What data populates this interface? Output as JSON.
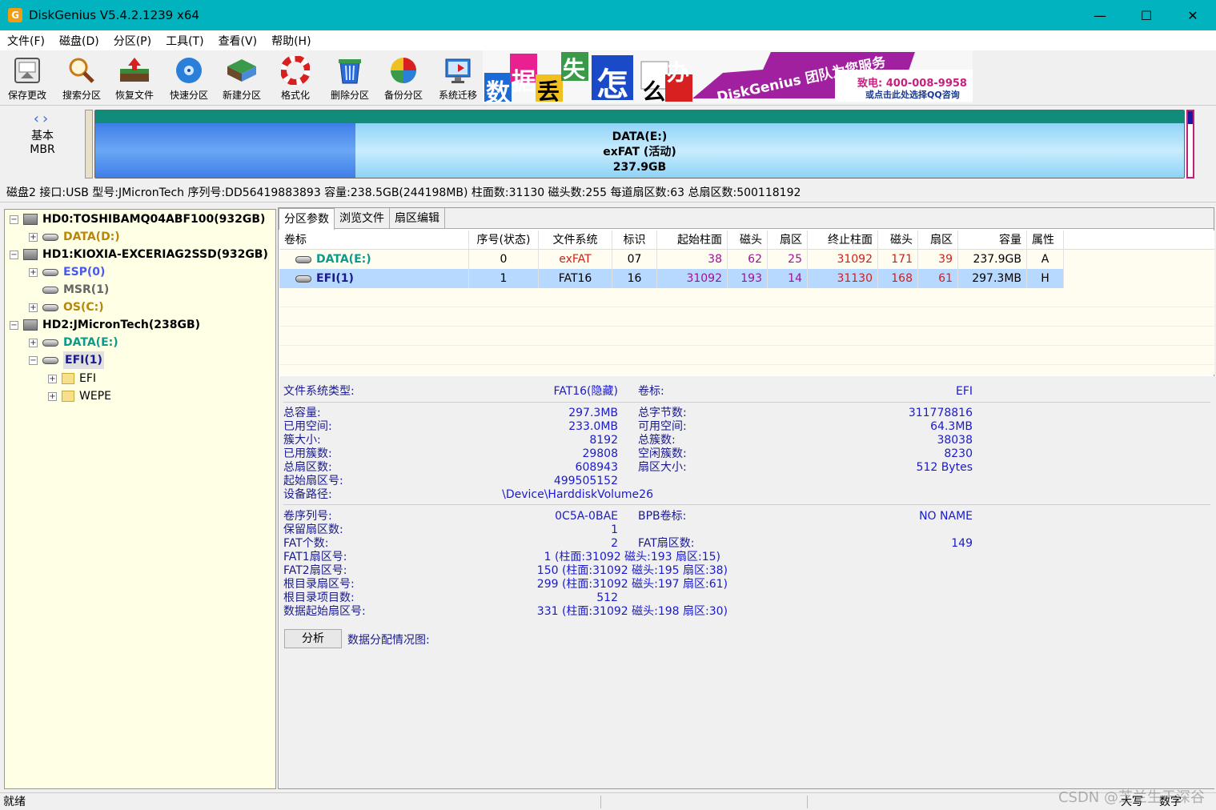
{
  "window": {
    "title": "DiskGenius V5.4.2.1239 x64",
    "app_icon_glyph": "G"
  },
  "menu": [
    "文件(F)",
    "磁盘(D)",
    "分区(P)",
    "工具(T)",
    "查看(V)",
    "帮助(H)"
  ],
  "toolbar": [
    {
      "label": "保存更改",
      "icon": "save-icon"
    },
    {
      "label": "搜索分区",
      "icon": "search-icon"
    },
    {
      "label": "恢复文件",
      "icon": "recover-icon"
    },
    {
      "label": "快速分区",
      "icon": "quick-partition-icon"
    },
    {
      "label": "新建分区",
      "icon": "new-partition-icon"
    },
    {
      "label": "格式化",
      "icon": "format-icon"
    },
    {
      "label": "删除分区",
      "icon": "delete-icon"
    },
    {
      "label": "备份分区",
      "icon": "backup-icon"
    },
    {
      "label": "系统迁移",
      "icon": "migrate-icon"
    }
  ],
  "banner": {
    "chars": [
      "数",
      "据",
      "丢",
      "失",
      "怎",
      "么",
      "办"
    ],
    "slogan": "DiskGenius 团队为您服务",
    "phone": "致电: 400-008-9958",
    "qq": "或点击此处选择QQ咨询"
  },
  "disk_map": {
    "type_line1": "基本",
    "type_line2": "MBR",
    "partition_name": "DATA(E:)",
    "partition_fs": "exFAT (活动)",
    "partition_size": "237.9GB"
  },
  "disk_info": "磁盘2 接口:USB  型号:JMicronTech  序列号:DD56419883893  容量:238.5GB(244198MB)  柱面数:31130  磁头数:255  每道扇区数:63  总扇区数:500118192",
  "tree": {
    "hd0": "HD0:TOSHIBAMQ04ABF100(932GB)",
    "hd0_data": "DATA(D:)",
    "hd1": "HD1:KIOXIA-EXCERIAG2SSD(932GB)",
    "hd1_esp": "ESP(0)",
    "hd1_msr": "MSR(1)",
    "hd1_os": "OS(C:)",
    "hd2": "HD2:JMicronTech(238GB)",
    "hd2_data": "DATA(E:)",
    "hd2_efi": "EFI(1)",
    "efi_folder": "EFI",
    "wepe_folder": "WEPE"
  },
  "tabs": [
    "分区参数",
    "浏览文件",
    "扇区编辑"
  ],
  "partition_table": {
    "headers": [
      "卷标",
      "序号(状态)",
      "文件系统",
      "标识",
      "起始柱面",
      "磁头",
      "扇区",
      "终止柱面",
      "磁头",
      "扇区",
      "容量",
      "属性"
    ],
    "rows": [
      [
        "DATA(E:)",
        "0",
        "exFAT",
        "07",
        "38",
        "62",
        "25",
        "31092",
        "171",
        "39",
        "237.9GB",
        "A"
      ],
      [
        "EFI(1)",
        "1",
        "FAT16",
        "16",
        "31092",
        "193",
        "14",
        "31130",
        "168",
        "61",
        "297.3MB",
        "H"
      ]
    ]
  },
  "details": {
    "fs_type_label": "文件系统类型:",
    "fs_type_value": "FAT16(隐藏)",
    "volume_label_label": "卷标:",
    "volume_label_value": "EFI",
    "total_capacity_label": "总容量:",
    "total_capacity_value": "297.3MB",
    "total_bytes_label": "总字节数:",
    "total_bytes_value": "311778816",
    "used_space_label": "已用空间:",
    "used_space_value": "233.0MB",
    "free_space_label": "可用空间:",
    "free_space_value": "64.3MB",
    "cluster_size_label": "簇大小:",
    "cluster_size_value": "8192",
    "total_clusters_label": "总簇数:",
    "total_clusters_value": "38038",
    "used_clusters_label": "已用簇数:",
    "used_clusters_value": "29808",
    "free_clusters_label": "空闲簇数:",
    "free_clusters_value": "8230",
    "total_sectors_label": "总扇区数:",
    "total_sectors_value": "608943",
    "sector_size_label": "扇区大小:",
    "sector_size_value": "512 Bytes",
    "start_sector_label": "起始扇区号:",
    "start_sector_value": "499505152",
    "device_path_label": "设备路径:",
    "device_path_value": "\\Device\\HarddiskVolume26",
    "serial_label": "卷序列号:",
    "serial_value": "0C5A-0BAE",
    "bpb_label": "BPB卷标:",
    "bpb_value": "NO NAME",
    "reserved_label": "保留扇区数:",
    "reserved_value": "1",
    "fat_count_label": "FAT个数:",
    "fat_count_value": "2",
    "fat_sectors_label": "FAT扇区数:",
    "fat_sectors_value": "149",
    "fat1_label": "FAT1扇区号:",
    "fat1_value": "1 (柱面:31092 磁头:193 扇区:15)",
    "fat2_label": "FAT2扇区号:",
    "fat2_value": "150 (柱面:31092 磁头:195 扇区:38)",
    "root_sector_label": "根目录扇区号:",
    "root_sector_value": "299 (柱面:31092 磁头:197 扇区:61)",
    "root_entries_label": "根目录项目数:",
    "root_entries_value": "512",
    "data_start_label": "数据起始扇区号:",
    "data_start_value": "331 (柱面:31092 磁头:198 扇区:30)",
    "analyze_button": "分析",
    "alloc_map_label": "数据分配情况图:"
  },
  "status": {
    "ready": "就绪",
    "caps": "大写",
    "num": "数字"
  },
  "watermark": "CSDN @芝兰生于深谷",
  "colors": {
    "titlebar": "#00b3bf",
    "selection": "#b8d9ff",
    "tree_bg": "#ffffe6"
  }
}
